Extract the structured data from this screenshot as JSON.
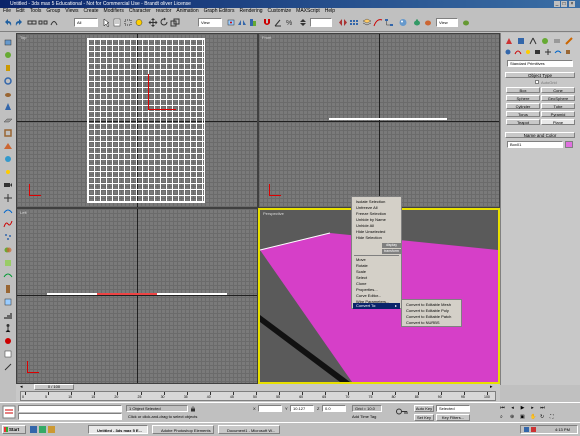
{
  "window": {
    "title": "Untitled - 3ds max 5 Educational - Not for Commercial Use - Brandt oliver License"
  },
  "menu": [
    "File",
    "Edit",
    "Tools",
    "Group",
    "Views",
    "Create",
    "Modifiers",
    "Character",
    "reactor",
    "Animation",
    "Graph Editors",
    "Rendering",
    "Customize",
    "MAXScript",
    "Help"
  ],
  "toolbar": {
    "selection_filter": "All",
    "ref_coord": "View",
    "named_set": "View"
  },
  "viewports": {
    "top": "Top",
    "front": "Front",
    "left": "Left",
    "perspective": "Perspective"
  },
  "cmdpanel": {
    "object_type_selector": "Standard Primitives",
    "object_type_header": "Object Type",
    "autogrid_label": "AutoGrid",
    "buttons": [
      "Box",
      "Cone",
      "Sphere",
      "GeoSphere",
      "Cylinder",
      "Tube",
      "Torus",
      "Pyramid",
      "Teapot",
      "Plane"
    ],
    "name_color_header": "Name and Color",
    "object_name": "Box01",
    "object_color": "#e070e0"
  },
  "context_menu": {
    "items_top": [
      "Isolate Selection",
      "Unfreeze All",
      "Freeze Selection",
      "Unhide by Name",
      "Unhide All",
      "Hide Unselected",
      "Hide Selection"
    ],
    "display_label": "display",
    "transform_label": "transform",
    "items_bottom": [
      "Move",
      "Rotate",
      "Scale",
      "Select",
      "Clone",
      "Properties...",
      "Curve Editor...",
      "Wire Parameters...",
      "Convert To:"
    ],
    "submenu": [
      "Convert to Editable Mesh",
      "Convert to Editable Poly",
      "Convert to Editable Patch",
      "Convert to NURBS"
    ]
  },
  "timeline": {
    "frame_counter": "0 / 100",
    "ticks": [
      "0",
      "5",
      "10",
      "15",
      "20",
      "25",
      "30",
      "35",
      "40",
      "45",
      "50",
      "55",
      "60",
      "65",
      "70",
      "75",
      "80",
      "85",
      "90",
      "95",
      "100"
    ]
  },
  "status": {
    "selection": "1 Object Selected",
    "prompt": "Click or click-and-drag to select objects",
    "x_label": "X",
    "x_value": "",
    "y_label": "Y",
    "y_value": "10.127",
    "z_label": "Z",
    "z_value": "0.0",
    "grid": "Grid = 10.0",
    "add_time_tag": "Add Time Tag",
    "autokey": "Auto Key",
    "autokey_mode": "Selected",
    "setkey": "Set Key",
    "key_filters": "Key Filters..."
  },
  "taskbar": {
    "start": "Start",
    "tasks": [
      "Untitled - 3ds max 5 E...",
      "Adobe Photoshop Elements",
      "Document1 - Microsoft W..."
    ],
    "clock": "4:13 PM"
  }
}
